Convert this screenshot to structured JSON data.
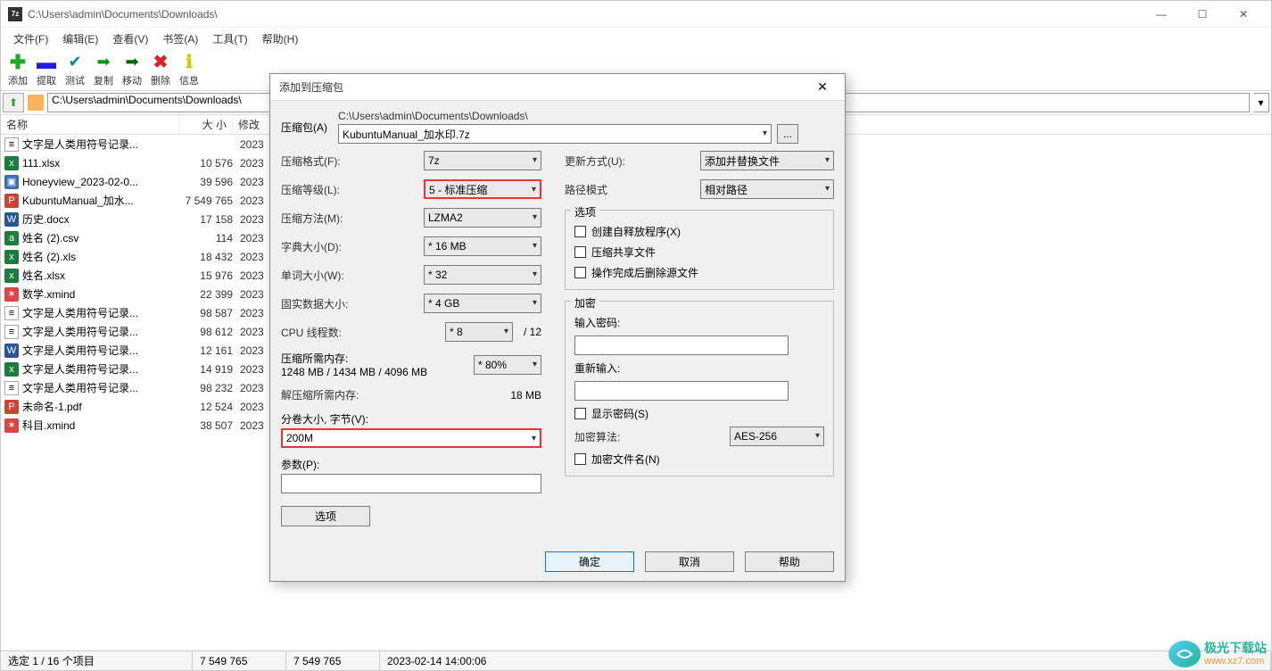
{
  "window": {
    "title": "C:\\Users\\admin\\Documents\\Downloads\\",
    "app_icon": "7z"
  },
  "menubar": [
    "文件(F)",
    "编辑(E)",
    "查看(V)",
    "书签(A)",
    "工具(T)",
    "帮助(H)"
  ],
  "toolbar": [
    {
      "icon": "plus",
      "label": "添加"
    },
    {
      "icon": "minus",
      "label": "提取"
    },
    {
      "icon": "check",
      "label": "测试"
    },
    {
      "icon": "arrow-r",
      "label": "复制"
    },
    {
      "icon": "arrow-r2",
      "label": "移动"
    },
    {
      "icon": "x",
      "label": "删除"
    },
    {
      "icon": "info",
      "label": "信息"
    }
  ],
  "address": "C:\\Users\\admin\\Documents\\Downloads\\",
  "columns": {
    "name": "名称",
    "size": "大 小",
    "date": "修改"
  },
  "files": [
    {
      "icon": "txt",
      "name": "文字是人类用符号记录...",
      "size": "",
      "date": "2023"
    },
    {
      "icon": "xlsx",
      "name": "111.xlsx",
      "size": "10 576",
      "date": "2023"
    },
    {
      "icon": "img",
      "name": "Honeyview_2023-02-0...",
      "size": "39 596",
      "date": "2023"
    },
    {
      "icon": "pdf",
      "name": "KubuntuManual_加水...",
      "size": "7 549 765",
      "date": "2023"
    },
    {
      "icon": "doc",
      "name": "历史.docx",
      "size": "17 158",
      "date": "2023"
    },
    {
      "icon": "csv",
      "name": "姓名 (2).csv",
      "size": "114",
      "date": "2023"
    },
    {
      "icon": "xlsx",
      "name": "姓名 (2).xls",
      "size": "18 432",
      "date": "2023"
    },
    {
      "icon": "xlsx",
      "name": "姓名.xlsx",
      "size": "15 976",
      "date": "2023"
    },
    {
      "icon": "xmind",
      "name": "数学.xmind",
      "size": "22 399",
      "date": "2023"
    },
    {
      "icon": "txt",
      "name": "文字是人类用符号记录...",
      "size": "98 587",
      "date": "2023"
    },
    {
      "icon": "txt",
      "name": "文字是人类用符号记录...",
      "size": "98 612",
      "date": "2023"
    },
    {
      "icon": "doc",
      "name": "文字是人类用符号记录...",
      "size": "12 161",
      "date": "2023"
    },
    {
      "icon": "xlsx",
      "name": "文字是人类用符号记录...",
      "size": "14 919",
      "date": "2023"
    },
    {
      "icon": "txt",
      "name": "文字是人类用符号记录...",
      "size": "98 232",
      "date": "2023"
    },
    {
      "icon": "pdf",
      "name": "未命名-1.pdf",
      "size": "12 524",
      "date": "2023"
    },
    {
      "icon": "xmind",
      "name": "科目.xmind",
      "size": "38 507",
      "date": "2023"
    }
  ],
  "statusbar": {
    "selection": "选定 1 / 16 个项目",
    "size1": "7 549 765",
    "size2": "7 549 765",
    "date": "2023-02-14 14:00:06"
  },
  "watermark": {
    "name": "极光下载站",
    "url": "www.xz7.com"
  },
  "dialog": {
    "title": "添加到压缩包",
    "archive_label": "压缩包(A)",
    "path": "C:\\Users\\admin\\Documents\\Downloads\\",
    "archive_name": "KubuntuManual_加水印.7z",
    "browse": "...",
    "left": {
      "format_label": "压缩格式(F):",
      "format": "7z",
      "level_label": "压缩等级(L):",
      "level": "5 - 标准压缩",
      "method_label": "压缩方法(M):",
      "method": "LZMA2",
      "dict_label": "字典大小(D):",
      "dict": "* 16 MB",
      "word_label": "单词大小(W):",
      "word": "* 32",
      "solid_label": "固实数据大小:",
      "solid": "* 4 GB",
      "cpu_label": "CPU 线程数:",
      "cpu": "* 8",
      "cpu_total": "/ 12",
      "mem_compress_label": "压缩所需内存:",
      "mem_compress": "1248 MB / 1434 MB / 4096 MB",
      "mem_pct": "* 80%",
      "mem_decompress_label": "解压缩所需内存:",
      "mem_decompress": "18 MB",
      "volume_label": "分卷大小, 字节(V):",
      "volume": "200M",
      "params_label": "参数(P):",
      "params": "",
      "option_btn": "选项"
    },
    "right": {
      "update_label": "更新方式(U):",
      "update": "添加并替换文件",
      "pathmode_label": "路径模式",
      "pathmode": "相对路径",
      "options_title": "选项",
      "opt_sfx": "创建自释放程序(X)",
      "opt_shared": "压缩共享文件",
      "opt_delete": "操作完成后删除源文件",
      "enc_title": "加密",
      "enc_pw_label": "输入密码:",
      "enc_pw2_label": "重新输入:",
      "enc_show": "显示密码(S)",
      "enc_alg_label": "加密算法:",
      "enc_alg": "AES-256",
      "enc_names": "加密文件名(N)"
    },
    "buttons": {
      "ok": "确定",
      "cancel": "取消",
      "help": "帮助"
    }
  }
}
